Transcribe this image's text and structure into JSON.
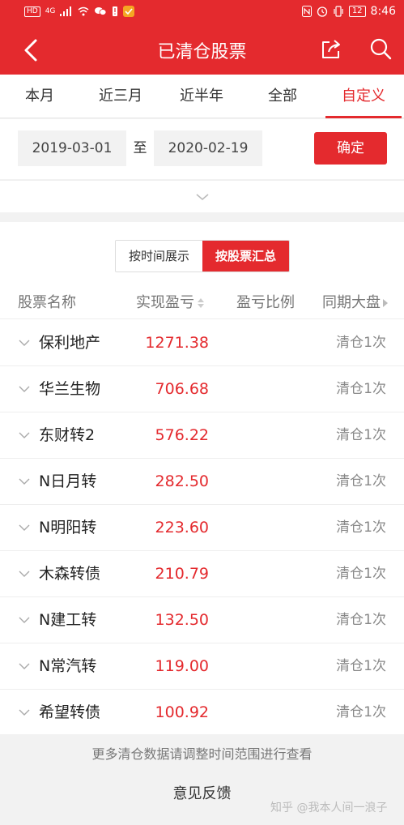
{
  "status_bar": {
    "network_hd": "HD",
    "network_type": "4G",
    "battery": "12",
    "time": "8:46"
  },
  "header": {
    "title": "已清仓股票"
  },
  "tabs": [
    {
      "label": "本月",
      "active": false
    },
    {
      "label": "近三月",
      "active": false
    },
    {
      "label": "近半年",
      "active": false
    },
    {
      "label": "全部",
      "active": false
    },
    {
      "label": "自定义",
      "active": true
    }
  ],
  "date_range": {
    "start": "2019-03-01",
    "separator": "至",
    "end": "2020-02-19",
    "confirm_label": "确定"
  },
  "view_toggle": {
    "by_time": "按时间展示",
    "by_stock": "按股票汇总",
    "selected": "by_stock"
  },
  "table": {
    "headers": {
      "name": "股票名称",
      "realized_pl": "实现盈亏",
      "pl_ratio": "盈亏比例",
      "market": "同期大盘"
    },
    "rows": [
      {
        "name": "保利地产",
        "pl": "1271.38",
        "count": "清仓1次"
      },
      {
        "name": "华兰生物",
        "pl": "706.68",
        "count": "清仓1次"
      },
      {
        "name": "东财转2",
        "pl": "576.22",
        "count": "清仓1次"
      },
      {
        "name": "N日月转",
        "pl": "282.50",
        "count": "清仓1次"
      },
      {
        "name": "N明阳转",
        "pl": "223.60",
        "count": "清仓1次"
      },
      {
        "name": "木森转债",
        "pl": "210.79",
        "count": "清仓1次"
      },
      {
        "name": "N建工转",
        "pl": "132.50",
        "count": "清仓1次"
      },
      {
        "name": "N常汽转",
        "pl": "119.00",
        "count": "清仓1次"
      },
      {
        "name": "希望转债",
        "pl": "100.92",
        "count": "清仓1次"
      }
    ]
  },
  "footer": {
    "note": "更多清仓数据请调整时间范围进行查看",
    "feedback": "意见反馈"
  },
  "watermark": "知乎 @我本人间一浪子",
  "colors": {
    "accent": "#e42a2e",
    "background": "#f2f2f2"
  },
  "icons": {
    "back": "back-arrow-icon",
    "share": "share-icon",
    "search": "search-icon",
    "expand": "chevron-down-icon",
    "sort": "sort-icon",
    "row_expand": "chevron-down-icon"
  }
}
